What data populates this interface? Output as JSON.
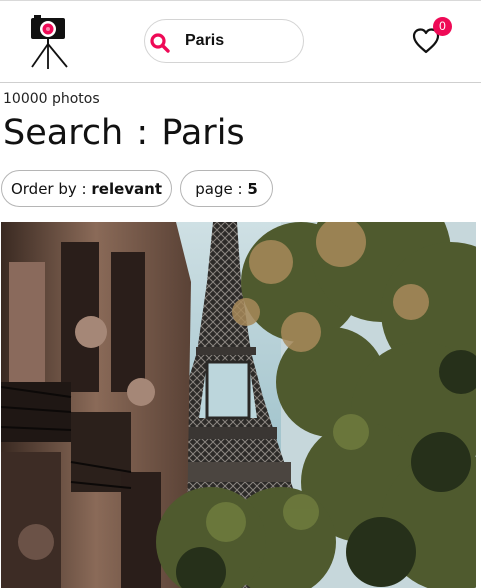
{
  "header": {
    "search": {
      "value": "Paris",
      "placeholder": ""
    },
    "favorites_count": "0"
  },
  "results": {
    "count_text": "10000 photos",
    "title_prefix": "Search",
    "title_separator": ":",
    "title_query": "Paris"
  },
  "filters": {
    "order_label": "Order by",
    "order_value": "relevant",
    "page_label": "page",
    "page_value": "5",
    "separator": ":"
  },
  "photo": {
    "subject": "Eiffel Tower between Haussmann buildings and trees"
  },
  "icons": {
    "logo": "camera-on-tripod-icon",
    "search": "search-icon",
    "favorites": "heart-icon"
  },
  "colors": {
    "accent": "#ee0a56",
    "text": "#111111",
    "border": "#d4d4d4"
  }
}
